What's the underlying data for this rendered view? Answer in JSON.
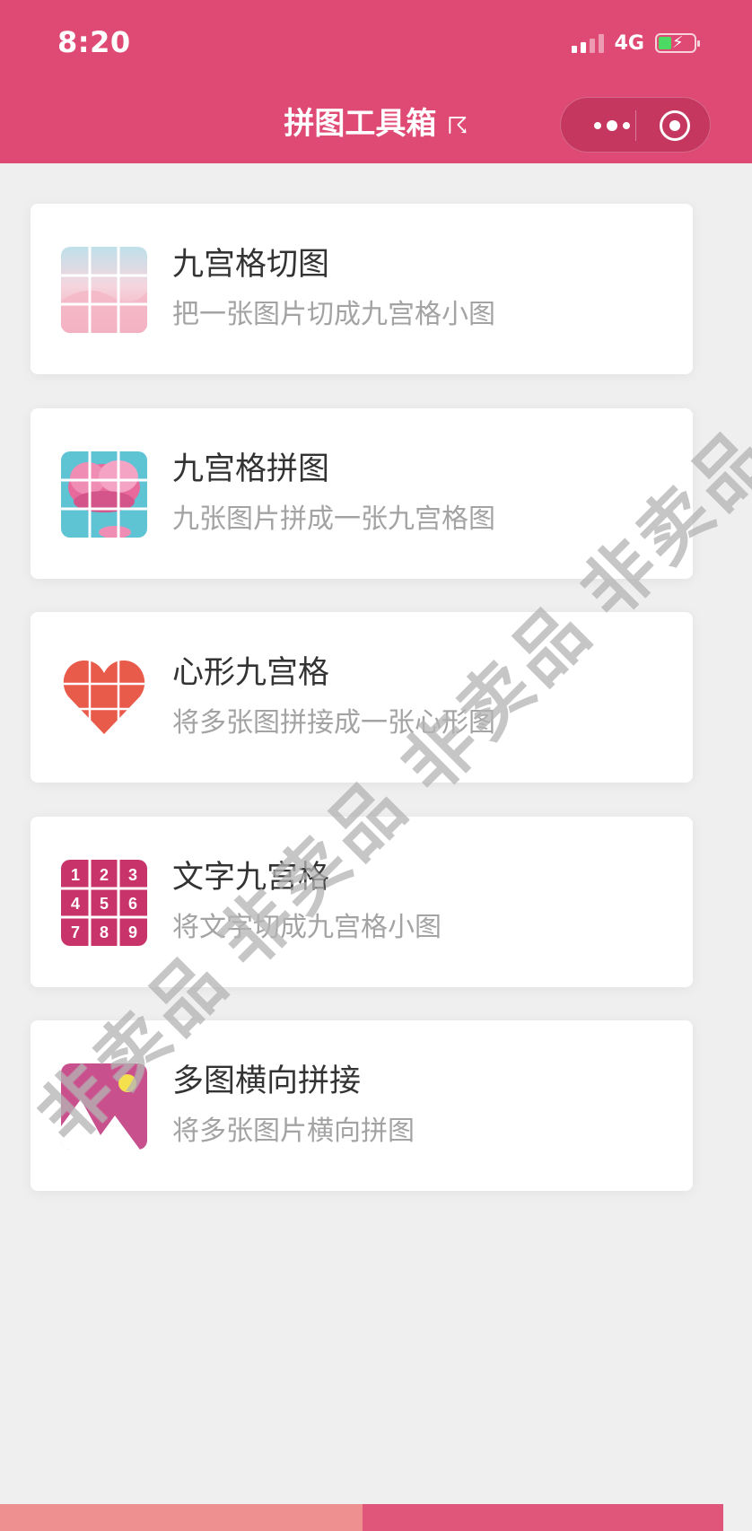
{
  "status": {
    "time": "8:20",
    "network": "4G"
  },
  "header": {
    "title": "拼图工具箱",
    "title_glyph": "☈"
  },
  "tools": [
    {
      "title": "九宫格切图",
      "subtitle": "把一张图片切成九宫格小图",
      "icon": "nine-grid-cut-icon"
    },
    {
      "title": "九宫格拼图",
      "subtitle": "九张图片拼成一张九宫格图",
      "icon": "nine-grid-collage-icon"
    },
    {
      "title": "心形九宫格",
      "subtitle": "将多张图拼接成一张心形图",
      "icon": "heart-grid-icon"
    },
    {
      "title": "文字九宫格",
      "subtitle": "将文字切成九宫格小图",
      "icon": "number-grid-icon"
    },
    {
      "title": "多图横向拼接",
      "subtitle": "将多张图片横向拼图",
      "icon": "image-stitch-icon"
    }
  ],
  "number_grid": [
    "1",
    "2",
    "3",
    "4",
    "5",
    "6",
    "7",
    "8",
    "9"
  ],
  "watermark": "非卖品",
  "colors": {
    "header": "#df4a74",
    "accent": "#c8336a",
    "heart": "#e85a4a"
  }
}
